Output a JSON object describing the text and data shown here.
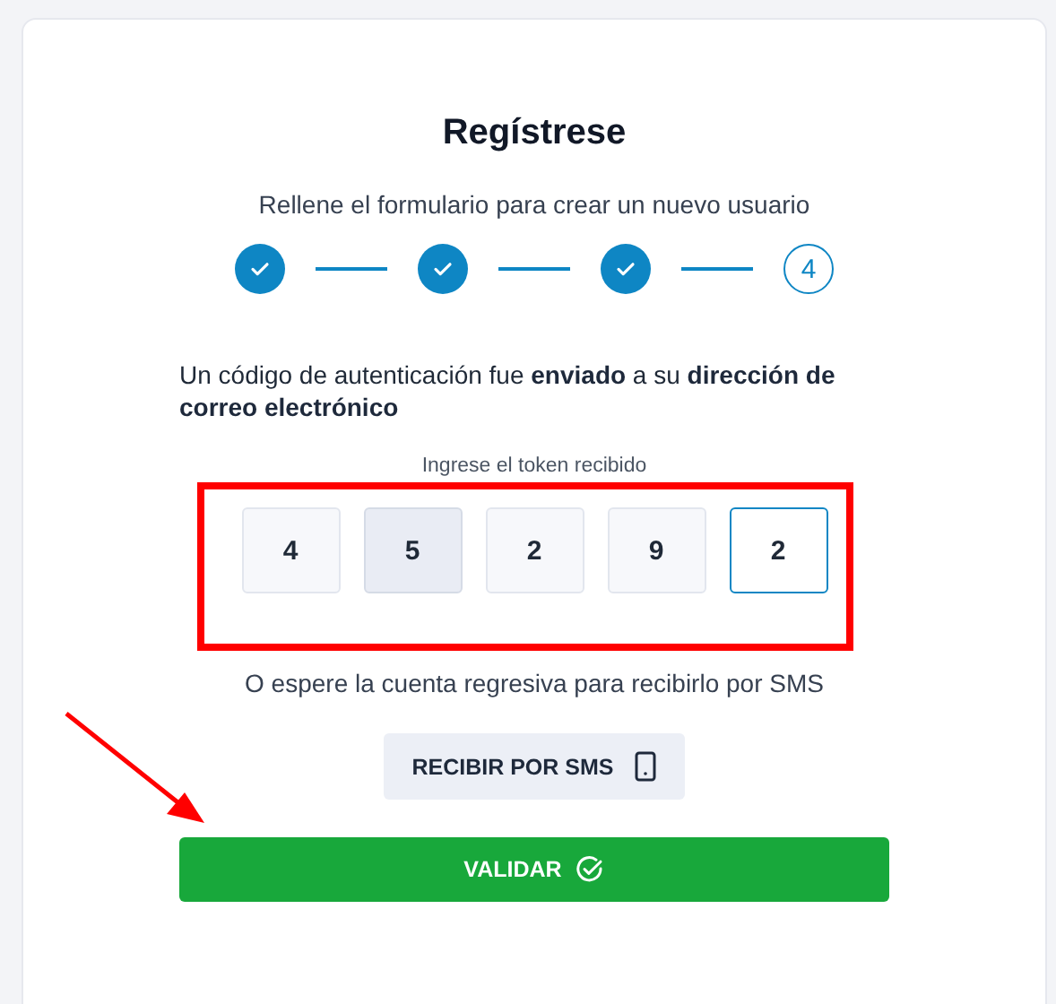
{
  "title": "Regístrese",
  "subtitle": "Rellene el formulario para crear un nuevo usuario",
  "steps": [
    {
      "done": true
    },
    {
      "done": true
    },
    {
      "done": true
    },
    {
      "done": false,
      "label": "4"
    }
  ],
  "message": "Un código de autenticación fue **enviado** a su **dirección de correo electrónico**",
  "token": {
    "label": "Ingrese el token recibido",
    "digits": [
      {
        "value": "4",
        "focused": false,
        "hovered": false
      },
      {
        "value": "5",
        "focused": false,
        "hovered": true
      },
      {
        "value": "2",
        "focused": false,
        "hovered": false
      },
      {
        "value": "9",
        "focused": false,
        "hovered": false
      },
      {
        "value": "2",
        "focused": true,
        "hovered": false
      }
    ]
  },
  "countdown_text": "O espere la cuenta regresiva para recibirlo por SMS",
  "sms_button": "RECIBIR POR SMS",
  "validate_button": "VALIDAR"
}
